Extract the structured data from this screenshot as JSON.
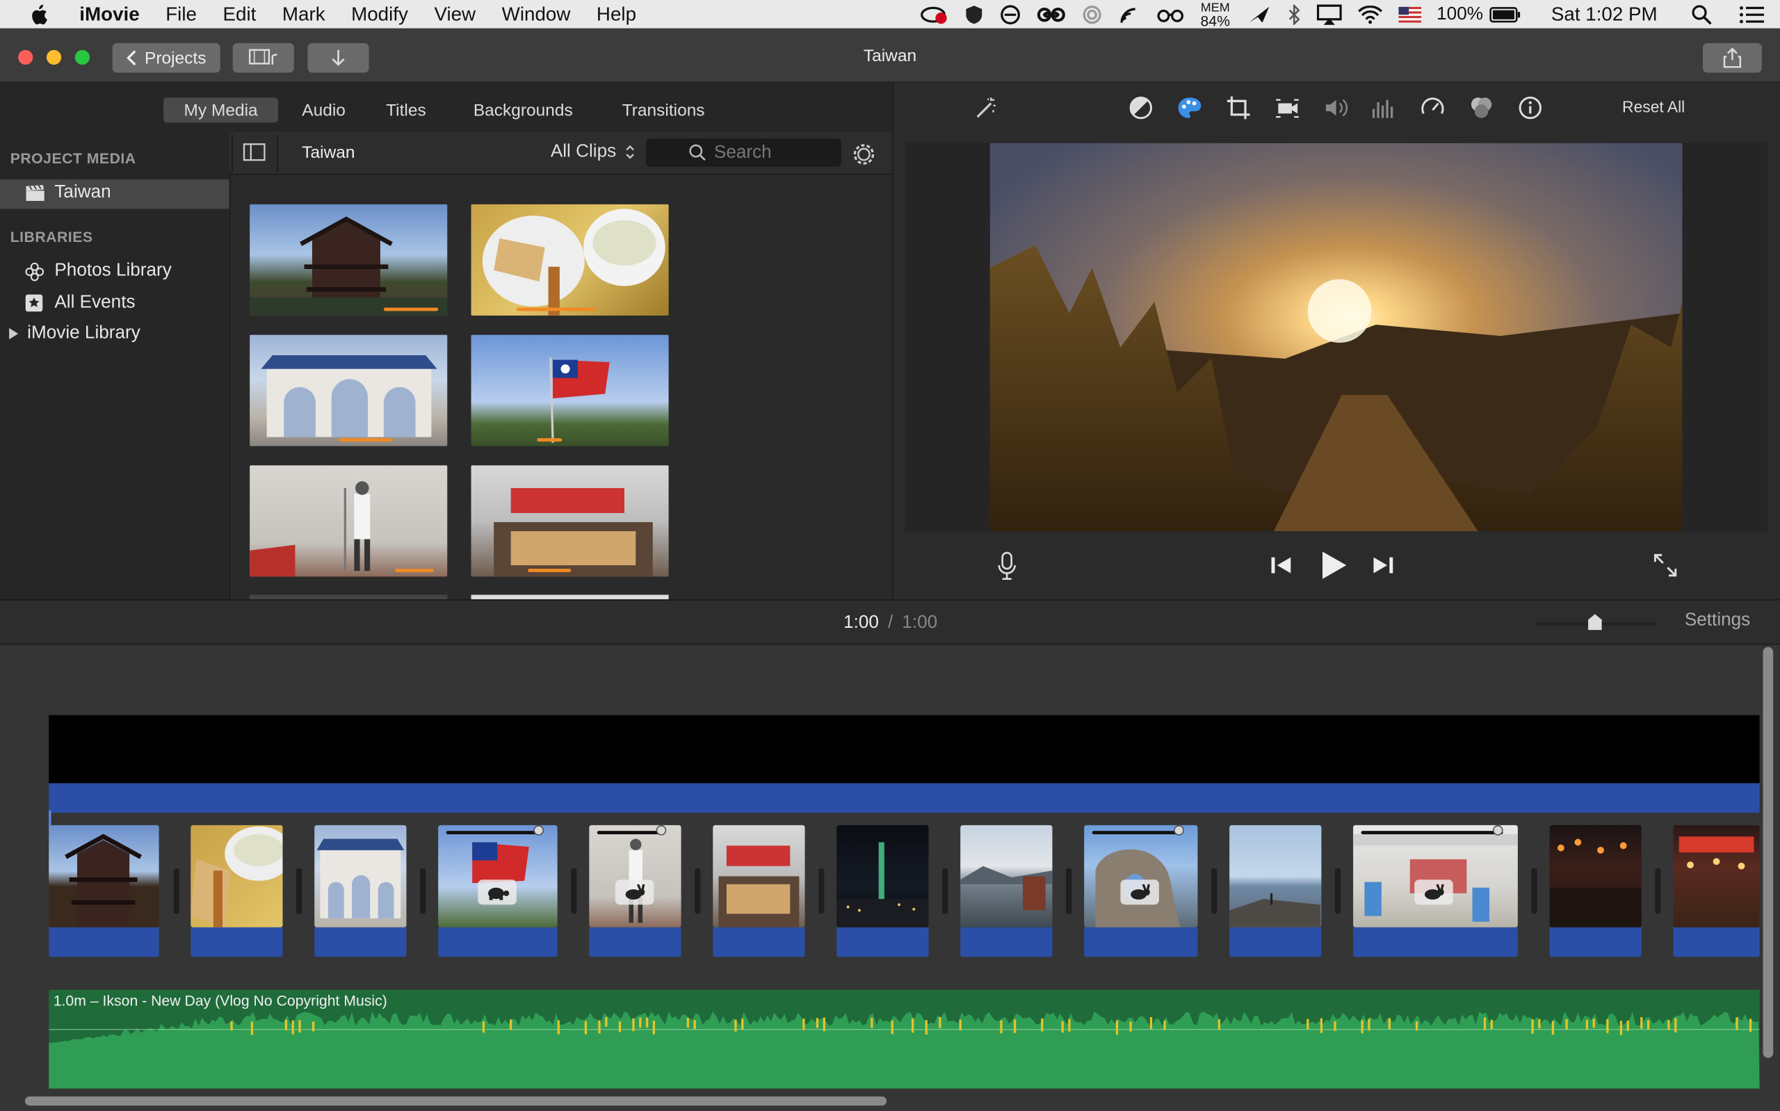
{
  "menubar": {
    "app": "iMovie",
    "items": [
      "File",
      "Edit",
      "Mark",
      "Modify",
      "View",
      "Window",
      "Help"
    ],
    "status": {
      "mem_label": "MEM",
      "mem_value": "84%",
      "battery": "100%",
      "clock": "Sat 1:02 PM"
    }
  },
  "window": {
    "title": "Taiwan",
    "projects_button": "Projects"
  },
  "browser_tabs": [
    "My Media",
    "Audio",
    "Titles",
    "Backgrounds",
    "Transitions"
  ],
  "sidebar": {
    "project_media_header": "PROJECT MEDIA",
    "project_item": "Taiwan",
    "libraries_header": "LIBRARIES",
    "library_items": [
      "Photos Library",
      "All Events",
      "iMovie Library"
    ]
  },
  "browser": {
    "title": "Taiwan",
    "filter": "All Clips",
    "search_placeholder": "Search"
  },
  "viewer": {
    "reset_all": "Reset All"
  },
  "timeline": {
    "current_time": "1:00",
    "separator": "/",
    "total_time": "1:00",
    "settings": "Settings",
    "audio_label": "1.0m – Ikson - New Day (Vlog No Copyright Music)"
  },
  "colors": {
    "accent": "#3a7bd5",
    "clip_blue": "#2b4fa6",
    "audio_green": "#2f9e54",
    "highlight_orange": "#f08a24"
  },
  "icons": [
    "apple-icon",
    "wand-icon",
    "color-balance-icon",
    "color-correction-icon",
    "crop-icon",
    "stabilization-icon",
    "volume-icon",
    "equalizer-icon",
    "speed-icon",
    "filter-icon",
    "info-icon",
    "microphone-icon",
    "skip-back-icon",
    "play-icon",
    "skip-forward-icon",
    "fullscreen-icon",
    "gear-icon",
    "search-icon",
    "sidebar-toggle-icon",
    "share-icon",
    "import-icon",
    "media-icon"
  ]
}
